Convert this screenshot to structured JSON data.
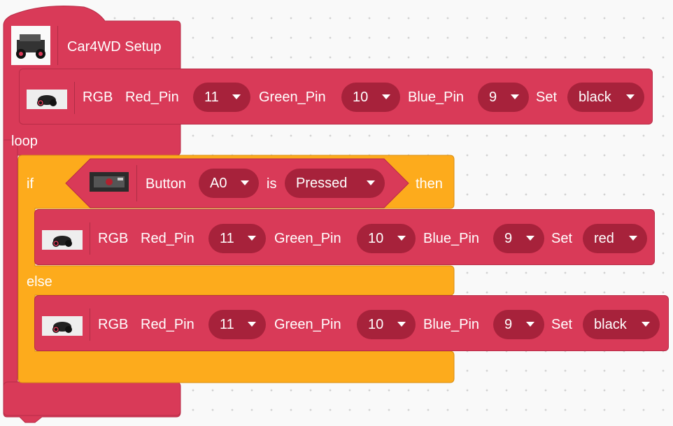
{
  "setup_block": {
    "label": "Car4WD Setup",
    "icon": "car-robot-icon"
  },
  "rgb_setup": {
    "label": "RGB",
    "red_pin_label": "Red_Pin",
    "red_pin": "11",
    "green_pin_label": "Green_Pin",
    "green_pin": "10",
    "blue_pin_label": "Blue_Pin",
    "blue_pin": "9",
    "set_label": "Set",
    "color": "black",
    "icon": "car-wheels-icon"
  },
  "loop_label": "loop",
  "if_block": {
    "if_label": "if",
    "then_label": "then",
    "else_label": "else",
    "condition": {
      "label": "Button",
      "pin": "A0",
      "is_label": "is",
      "state": "Pressed",
      "icon": "button-module-icon"
    }
  },
  "rgb_then": {
    "label": "RGB",
    "red_pin_label": "Red_Pin",
    "red_pin": "11",
    "green_pin_label": "Green_Pin",
    "green_pin": "10",
    "blue_pin_label": "Blue_Pin",
    "blue_pin": "9",
    "set_label": "Set",
    "color": "red",
    "icon": "car-wheels-icon"
  },
  "rgb_else": {
    "label": "RGB",
    "red_pin_label": "Red_Pin",
    "red_pin": "11",
    "green_pin_label": "Green_Pin",
    "green_pin": "10",
    "blue_pin_label": "Blue_Pin",
    "blue_pin": "9",
    "set_label": "Set",
    "color": "black",
    "icon": "car-wheels-icon"
  },
  "colors": {
    "block_red": "#d93a58",
    "block_red_dark": "#a7223b",
    "block_orange": "#fdab1c",
    "canvas": "#f9f9f9"
  }
}
